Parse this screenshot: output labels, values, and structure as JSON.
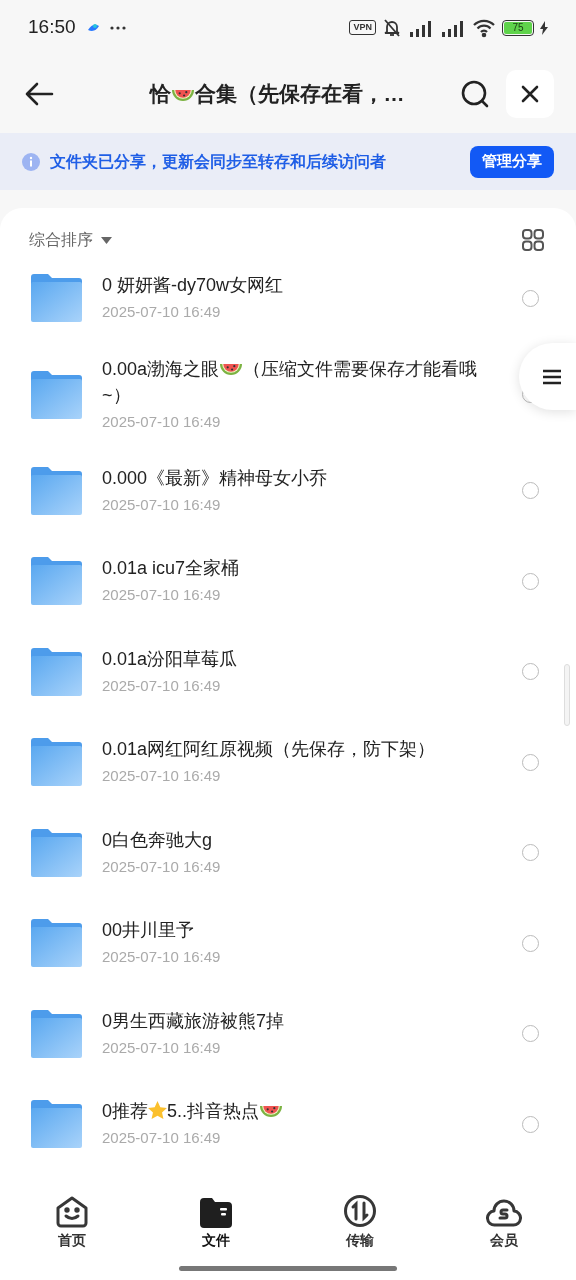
{
  "status_bar": {
    "time": "16:50",
    "vpn": "VPN",
    "battery": "75"
  },
  "header": {
    "title": [
      {
        "kind": "text",
        "text": "恰"
      },
      {
        "kind": "watermelon"
      },
      {
        "kind": "text",
        "text": "合集（先保存在看，…"
      }
    ]
  },
  "banner": {
    "text": "文件夹已分享，更新会同步至转存和后续访问者",
    "button": "管理分享"
  },
  "sort": {
    "label": "综合排序"
  },
  "files": [
    {
      "name": [
        {
          "kind": "text",
          "text": "0 妍妍酱-dy70w女网红"
        }
      ],
      "date": "2025-07-10 16:49",
      "checked": false
    },
    {
      "name": [
        {
          "kind": "text",
          "text": "0.00a渤海之眼"
        },
        {
          "kind": "watermelon"
        },
        {
          "kind": "text",
          "text": "（压缩文件需要保存才能看哦~）"
        }
      ],
      "date": "2025-07-10 16:49",
      "checked": false
    },
    {
      "name": [
        {
          "kind": "text",
          "text": "0.000《最新》精神母女小乔"
        }
      ],
      "date": "2025-07-10 16:49",
      "checked": false
    },
    {
      "name": [
        {
          "kind": "text",
          "text": "0.01a icu7全家桶"
        }
      ],
      "date": "2025-07-10 16:49",
      "checked": false
    },
    {
      "name": [
        {
          "kind": "text",
          "text": "0.01a汾阳草莓瓜"
        }
      ],
      "date": "2025-07-10 16:49",
      "checked": false
    },
    {
      "name": [
        {
          "kind": "text",
          "text": "0.01a网红阿红原视频（先保存，防下架）"
        }
      ],
      "date": "2025-07-10 16:49",
      "checked": false
    },
    {
      "name": [
        {
          "kind": "text",
          "text": "0白色奔驰大g"
        }
      ],
      "date": "2025-07-10 16:49",
      "checked": false
    },
    {
      "name": [
        {
          "kind": "text",
          "text": "00井川里予"
        }
      ],
      "date": "2025-07-10 16:49",
      "checked": false
    },
    {
      "name": [
        {
          "kind": "text",
          "text": "0男生西藏旅游被熊7掉"
        }
      ],
      "date": "2025-07-10 16:49",
      "checked": false
    },
    {
      "name": [
        {
          "kind": "text",
          "text": "0推荐"
        },
        {
          "kind": "star"
        },
        {
          "kind": "text",
          "text": "5..抖音热点"
        },
        {
          "kind": "watermelon"
        }
      ],
      "date": "2025-07-10 16:49",
      "checked": false
    }
  ],
  "tabs": [
    {
      "kind": "home",
      "label": "首页",
      "selected": false
    },
    {
      "kind": "files",
      "label": "文件",
      "selected": true
    },
    {
      "kind": "transfer",
      "label": "传输",
      "selected": false
    },
    {
      "kind": "vip",
      "label": "会员",
      "selected": false
    }
  ]
}
